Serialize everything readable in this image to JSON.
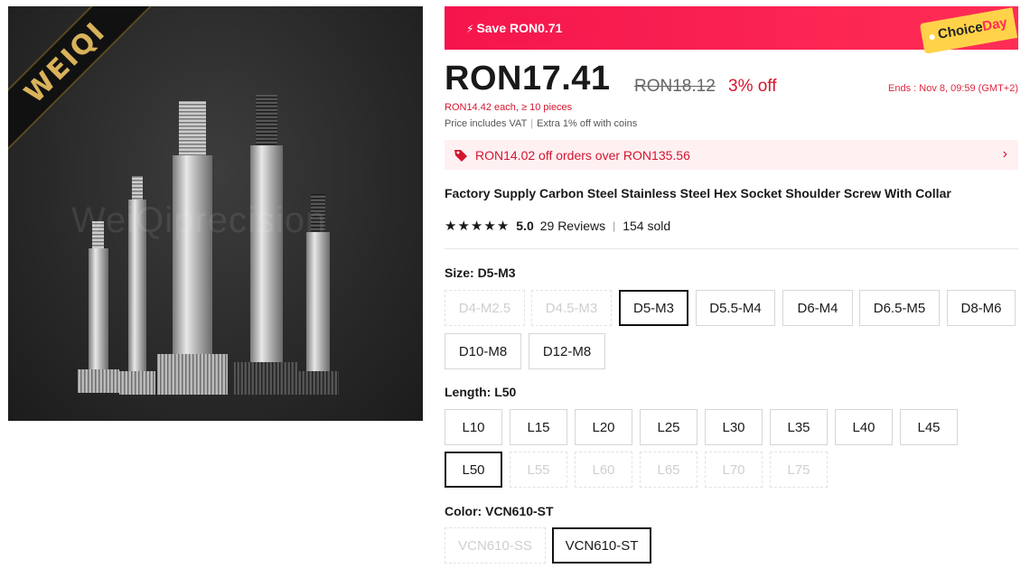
{
  "image": {
    "watermark": "WeiQiprecision",
    "ribbon": "WEIQI"
  },
  "banner": {
    "save": "Save RON0.71",
    "choice_a": "Choice",
    "choice_b": "Day"
  },
  "price": {
    "current": "RON17.41",
    "original": "RON18.12",
    "discount": "3% off",
    "ends": "Ends :  Nov 8, 09:59 (GMT+2)",
    "bulk": "RON14.42 each, ≥ 10 pieces",
    "vat": "Price includes VAT",
    "coins": "Extra 1% off with coins"
  },
  "coupon": {
    "text": "RON14.02 off orders over RON135.56"
  },
  "product": {
    "title": "Factory Supply Carbon Steel Stainless Steel Hex Socket Shoulder Screw With Collar",
    "score": "5.0",
    "reviews": "29 Reviews",
    "sold": "154 sold"
  },
  "size": {
    "label": "Size: D5-M3",
    "options": [
      "D4-M2.5",
      "D4.5-M3",
      "D5-M3",
      "D5.5-M4",
      "D6-M4",
      "D6.5-M5",
      "D8-M6",
      "D10-M8",
      "D12-M8"
    ]
  },
  "length": {
    "label": "Length: L50",
    "options": [
      "L10",
      "L15",
      "L20",
      "L25",
      "L30",
      "L35",
      "L40",
      "L45",
      "L50",
      "L55",
      "L60",
      "L65",
      "L70",
      "L75"
    ]
  },
  "color": {
    "label": "Color: VCN610-ST",
    "options": [
      "VCN610-SS",
      "VCN610-ST"
    ]
  },
  "colors": {
    "accent": "#ff2d56",
    "price_red": "#d4162f",
    "tag_yellow": "#ffd24a"
  }
}
